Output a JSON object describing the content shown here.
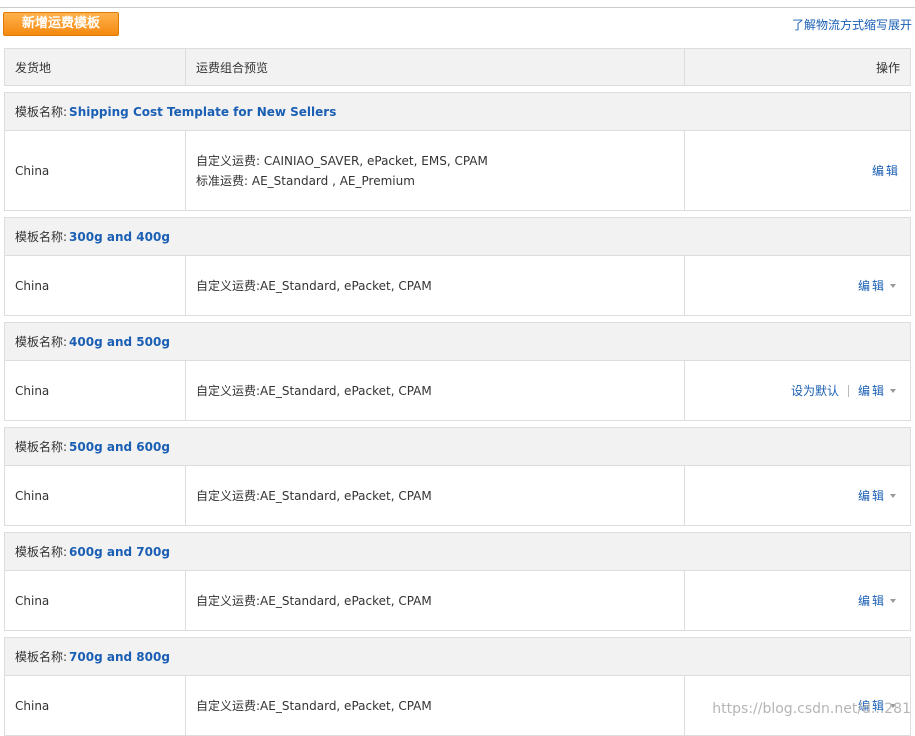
{
  "toolbar": {
    "add_button": "新增运费模板",
    "learn_link": "了解物流方式缩写展开"
  },
  "table": {
    "headers": [
      "发货地",
      "运费组合预览",
      "操作"
    ]
  },
  "labels": {
    "template_name_prefix": "模板名称:",
    "custom_shipping_prefix": "自定义运费:",
    "standard_shipping_prefix": "标准运费:",
    "edit": "编辑",
    "set_default": "设为默认"
  },
  "templates": [
    {
      "name": "Shipping Cost Template for New Sellers",
      "origin": "China",
      "custom": "CAINIAO_SAVER, ePacket, EMS, CPAM",
      "standard": "AE_Standard , AE_Premium"
    },
    {
      "name": "300g and 400g",
      "origin": "China",
      "custom": "AE_Standard, ePacket, CPAM"
    },
    {
      "name": "400g and 500g",
      "origin": "China",
      "custom": "AE_Standard, ePacket, CPAM"
    },
    {
      "name": "500g and 600g",
      "origin": "China",
      "custom": "AE_Standard, ePacket, CPAM"
    },
    {
      "name": "600g and 700g",
      "origin": "China",
      "custom": "AE_Standard, ePacket, CPAM"
    },
    {
      "name": "700g and 800g",
      "origin": "China",
      "custom": "AE_Standard, ePacket, CPAM"
    }
  ],
  "watermark": "https://blog.csdn.net/d...281"
}
